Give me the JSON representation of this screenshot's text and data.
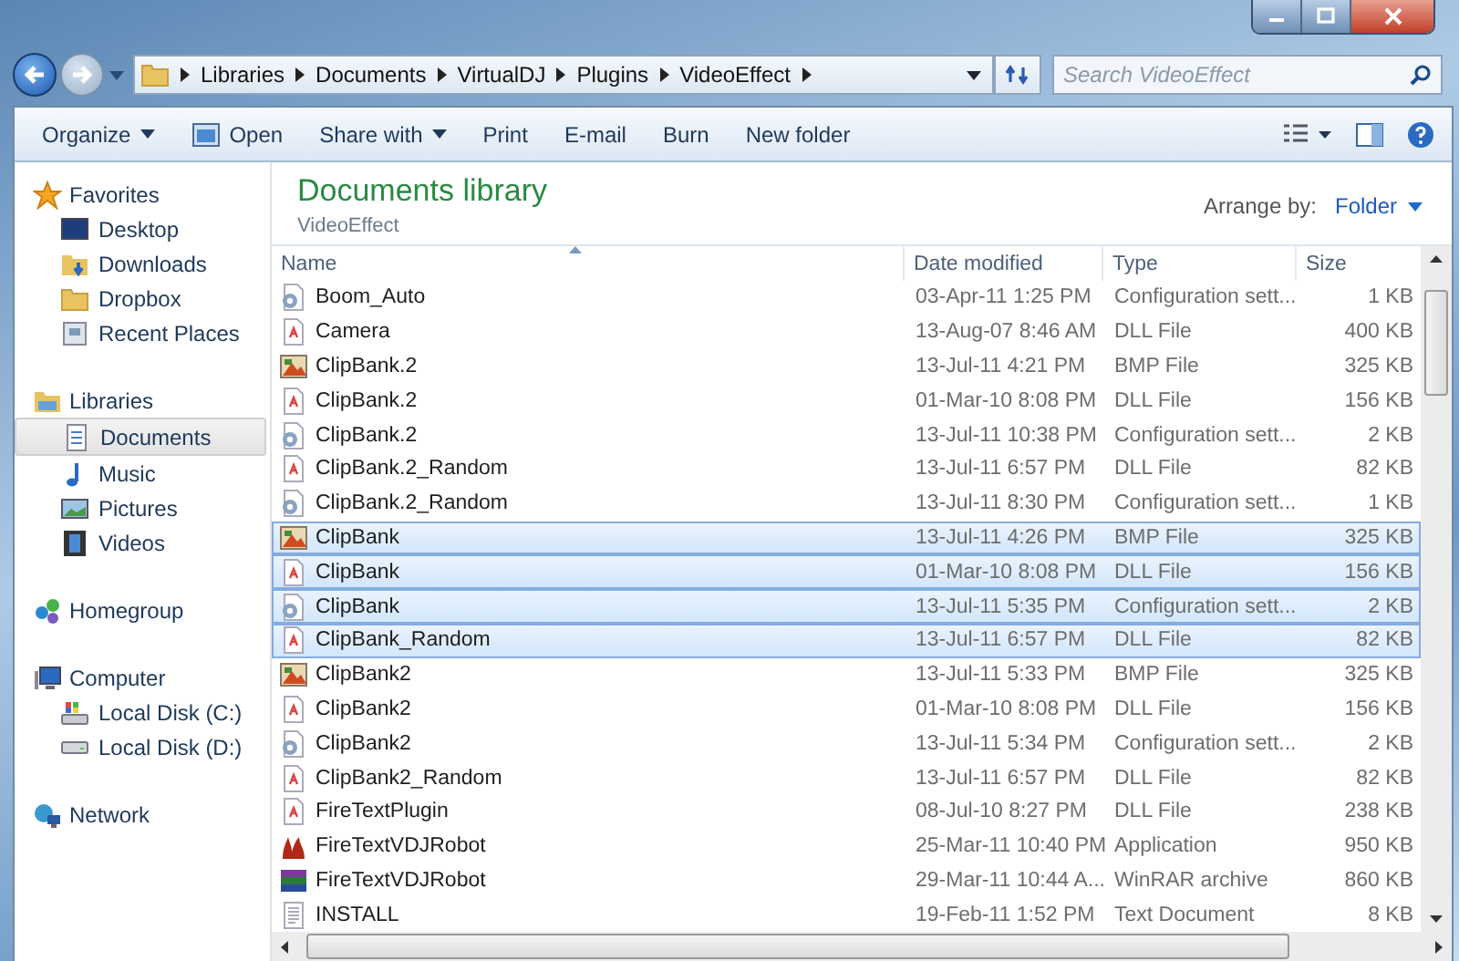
{
  "address": {
    "crumbs": [
      "Libraries",
      "Documents",
      "VirtualDJ",
      "Plugins",
      "VideoEffect"
    ]
  },
  "search": {
    "placeholder": "Search VideoEffect"
  },
  "toolbar": [
    {
      "label": "Organize",
      "dropdown": true,
      "icon": false
    },
    {
      "label": "Open",
      "dropdown": false,
      "icon": true
    },
    {
      "label": "Share with",
      "dropdown": true,
      "icon": false
    },
    {
      "label": "Print",
      "dropdown": false,
      "icon": false
    },
    {
      "label": "E-mail",
      "dropdown": false,
      "icon": false
    },
    {
      "label": "Burn",
      "dropdown": false,
      "icon": false
    },
    {
      "label": "New folder",
      "dropdown": false,
      "icon": false
    }
  ],
  "sidebar": {
    "groups": [
      {
        "label": "Favorites",
        "kind": "star",
        "items": [
          {
            "label": "Desktop",
            "kind": "desktop",
            "selected": false
          },
          {
            "label": "Downloads",
            "kind": "downloads",
            "selected": false
          },
          {
            "label": "Dropbox",
            "kind": "folder",
            "selected": false
          },
          {
            "label": "Recent Places",
            "kind": "recent",
            "selected": false
          }
        ]
      },
      {
        "label": "Libraries",
        "kind": "library",
        "items": [
          {
            "label": "Documents",
            "kind": "document",
            "selected": true
          },
          {
            "label": "Music",
            "kind": "music",
            "selected": false
          },
          {
            "label": "Pictures",
            "kind": "pictures",
            "selected": false
          },
          {
            "label": "Videos",
            "kind": "videos",
            "selected": false
          }
        ]
      },
      {
        "label": "Homegroup",
        "kind": "homegroup"
      },
      {
        "label": "Computer",
        "kind": "computer",
        "items": [
          {
            "label": "Local Disk (C:)",
            "kind": "system-disk",
            "selected": false
          },
          {
            "label": "Local Disk (D:)",
            "kind": "disk",
            "selected": false
          }
        ]
      },
      {
        "label": "Network",
        "kind": "network"
      }
    ]
  },
  "library": {
    "title": "Documents library",
    "subtitle": "VideoEffect",
    "arrange_label": "Arrange by:",
    "arrange_value": "Folder"
  },
  "table": {
    "columns": [
      "Name",
      "Date modified",
      "Type",
      "Size"
    ],
    "rows": [
      {
        "name": "Boom_Auto",
        "date": "03-Apr-11 1:25 PM",
        "type": "Configuration sett...",
        "size": "1 KB",
        "kind": "config",
        "selected": false
      },
      {
        "name": "Camera",
        "date": "13-Aug-07 8:46 AM",
        "type": "DLL File",
        "size": "400 KB",
        "kind": "dll",
        "selected": false
      },
      {
        "name": "ClipBank.2",
        "date": "13-Jul-11 4:21 PM",
        "type": "BMP File",
        "size": "325 KB",
        "kind": "bmp",
        "selected": false
      },
      {
        "name": "ClipBank.2",
        "date": "01-Mar-10 8:08 PM",
        "type": "DLL File",
        "size": "156 KB",
        "kind": "dll",
        "selected": false
      },
      {
        "name": "ClipBank.2",
        "date": "13-Jul-11 10:38 PM",
        "type": "Configuration sett...",
        "size": "2 KB",
        "kind": "config",
        "selected": false
      },
      {
        "name": "ClipBank.2_Random",
        "date": "13-Jul-11 6:57 PM",
        "type": "DLL File",
        "size": "82 KB",
        "kind": "dll",
        "selected": false
      },
      {
        "name": "ClipBank.2_Random",
        "date": "13-Jul-11 8:30 PM",
        "type": "Configuration sett...",
        "size": "1 KB",
        "kind": "config",
        "selected": false
      },
      {
        "name": "ClipBank",
        "date": "13-Jul-11 4:26 PM",
        "type": "BMP File",
        "size": "325 KB",
        "kind": "bmp",
        "selected": true
      },
      {
        "name": "ClipBank",
        "date": "01-Mar-10 8:08 PM",
        "type": "DLL File",
        "size": "156 KB",
        "kind": "dll",
        "selected": true
      },
      {
        "name": "ClipBank",
        "date": "13-Jul-11 5:35 PM",
        "type": "Configuration sett...",
        "size": "2 KB",
        "kind": "config",
        "selected": true
      },
      {
        "name": "ClipBank_Random",
        "date": "13-Jul-11 6:57 PM",
        "type": "DLL File",
        "size": "82 KB",
        "kind": "dll",
        "selected": true
      },
      {
        "name": "ClipBank2",
        "date": "13-Jul-11 5:33 PM",
        "type": "BMP File",
        "size": "325 KB",
        "kind": "bmp",
        "selected": false
      },
      {
        "name": "ClipBank2",
        "date": "01-Mar-10 8:08 PM",
        "type": "DLL File",
        "size": "156 KB",
        "kind": "dll",
        "selected": false
      },
      {
        "name": "ClipBank2",
        "date": "13-Jul-11 5:34 PM",
        "type": "Configuration sett...",
        "size": "2 KB",
        "kind": "config",
        "selected": false
      },
      {
        "name": "ClipBank2_Random",
        "date": "13-Jul-11 6:57 PM",
        "type": "DLL File",
        "size": "82 KB",
        "kind": "dll",
        "selected": false
      },
      {
        "name": "FireTextPlugin",
        "date": "08-Jul-10 8:27 PM",
        "type": "DLL File",
        "size": "238 KB",
        "kind": "dll",
        "selected": false
      },
      {
        "name": "FireTextVDJRobot",
        "date": "25-Mar-11 10:40 PM",
        "type": "Application",
        "size": "950 KB",
        "kind": "app",
        "selected": false
      },
      {
        "name": "FireTextVDJRobot",
        "date": "29-Mar-11 10:44 A...",
        "type": "WinRAR archive",
        "size": "860 KB",
        "kind": "archive",
        "selected": false
      },
      {
        "name": "INSTALL",
        "date": "19-Feb-11 1:52 PM",
        "type": "Text Document",
        "size": "8 KB",
        "kind": "text",
        "selected": false
      }
    ]
  }
}
